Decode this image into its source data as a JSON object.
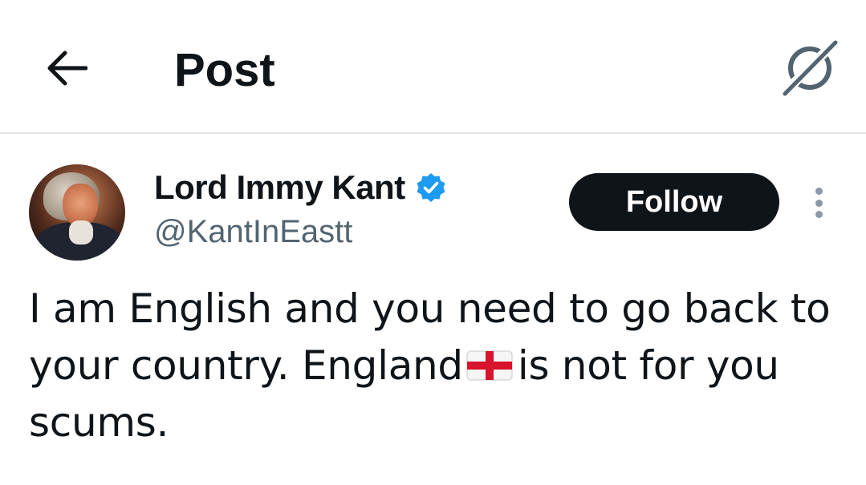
{
  "header": {
    "back_icon": "arrow-left-icon",
    "title": "Post",
    "grok_icon": "grok-icon"
  },
  "post": {
    "author": {
      "display_name": "Lord Immy Kant",
      "handle": "@KantInEastt",
      "verified": true,
      "verified_color": "#1d9bf0"
    },
    "follow_label": "Follow",
    "more_icon": "more-vertical-icon",
    "text_part1": "I am English and you need to go back to your country. England",
    "flag_emoji": "england-flag-icon",
    "text_part2": "is not for you scums."
  }
}
